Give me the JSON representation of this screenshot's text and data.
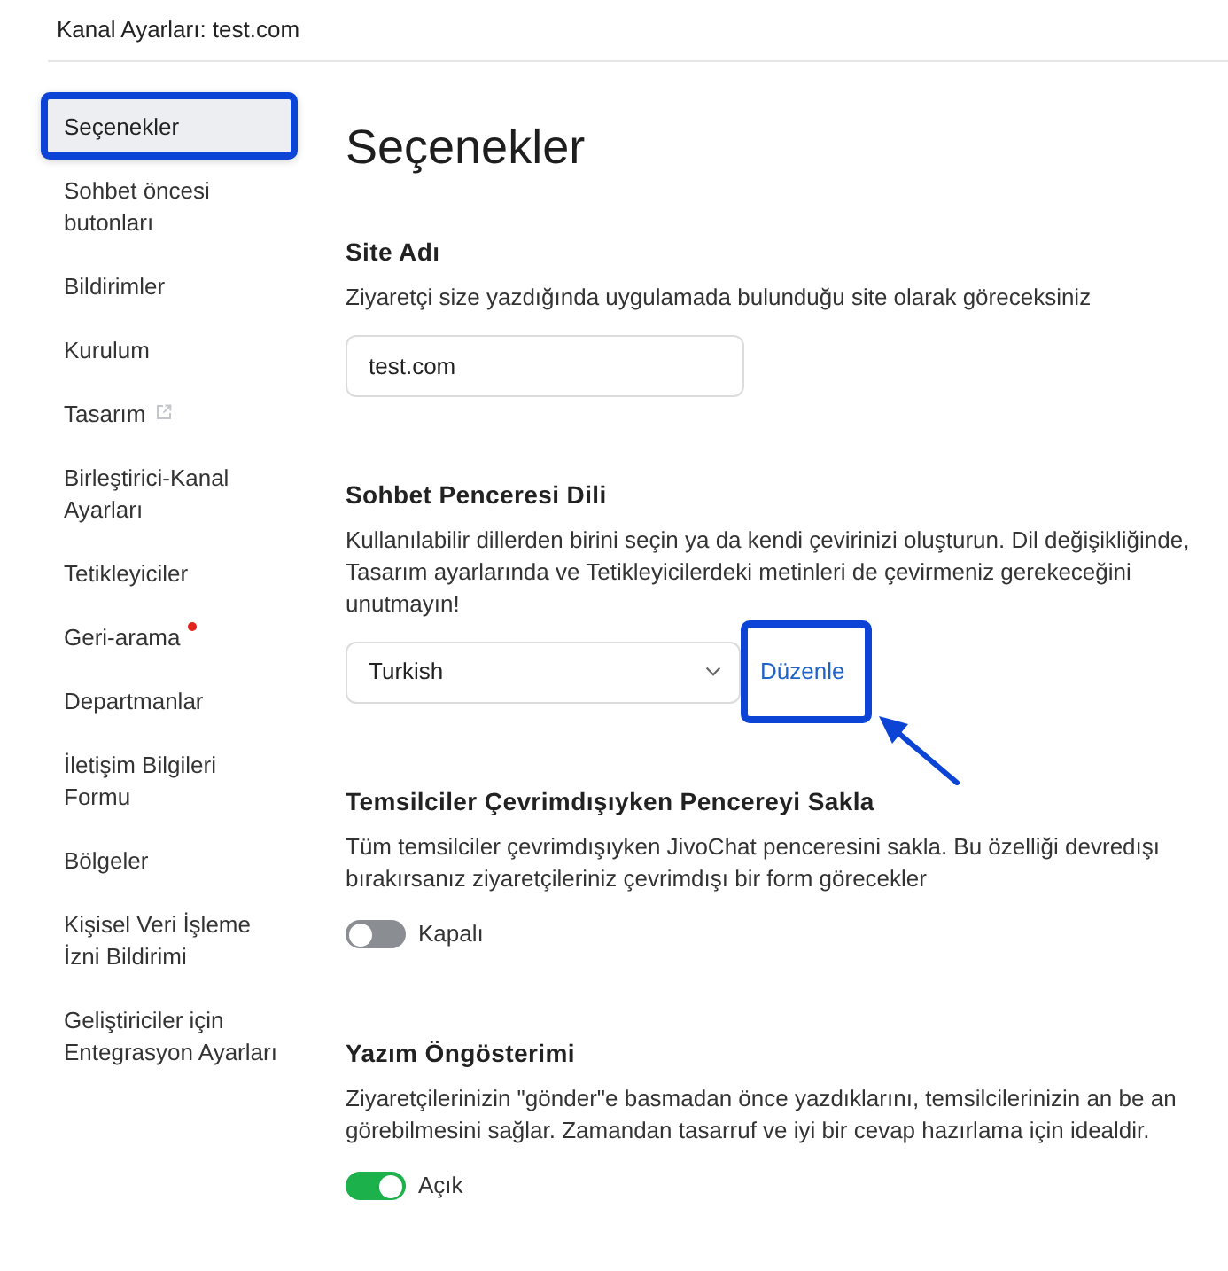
{
  "header": {
    "title": "Kanal Ayarları: test.com"
  },
  "sidebar": {
    "items": [
      {
        "label": "Seçenekler",
        "kind": "plain",
        "selected": true,
        "highlighted": true
      },
      {
        "label": "Sohbet öncesi butonları",
        "kind": "plain",
        "selected": false,
        "highlighted": false
      },
      {
        "label": "Bildirimler",
        "kind": "plain",
        "selected": false,
        "highlighted": false
      },
      {
        "label": "Kurulum",
        "kind": "plain",
        "selected": false,
        "highlighted": false
      },
      {
        "label": "Tasarım",
        "kind": "external",
        "selected": false,
        "highlighted": false
      },
      {
        "label": "Birleştirici-Kanal Ayarları",
        "kind": "plain",
        "selected": false,
        "highlighted": false
      },
      {
        "label": "Tetikleyiciler",
        "kind": "plain",
        "selected": false,
        "highlighted": false
      },
      {
        "label": "Geri-arama",
        "kind": "notification",
        "selected": false,
        "highlighted": false
      },
      {
        "label": "Departmanlar",
        "kind": "plain",
        "selected": false,
        "highlighted": false
      },
      {
        "label": "İletişim Bilgileri Formu",
        "kind": "plain",
        "selected": false,
        "highlighted": false
      },
      {
        "label": "Bölgeler",
        "kind": "plain",
        "selected": false,
        "highlighted": false
      },
      {
        "label": "Kişisel Veri İşleme İzni Bildirimi",
        "kind": "plain",
        "selected": false,
        "highlighted": false
      },
      {
        "label": "Geliştiriciler için Entegrasyon Ayarları",
        "kind": "plain",
        "selected": false,
        "highlighted": false
      }
    ]
  },
  "main": {
    "heading": "Seçenekler",
    "sections": [
      {
        "kind": "text_field",
        "title": "Site Adı",
        "description": "Ziyaretçi size yazdığında uygulamada bulunduğu site olarak göreceksiniz",
        "value": "test.com"
      },
      {
        "kind": "select",
        "title": "Sohbet Penceresi Dili",
        "description": "Kullanılabilir dillerden birini seçin ya da kendi çevirinizi oluşturun. Dil değişikliğinde, Tasarım ayarlarında ve Tetikleyicilerdeki metinleri de çevirmeniz gerekeceğini unutmayın!",
        "value": "Turkish",
        "link": {
          "label": "Düzenle",
          "highlighted": true,
          "callout_arrow": true
        }
      },
      {
        "kind": "toggle",
        "title": "Temsilciler Çevrimdışıyken Pencereyi Sakla",
        "description": "Tüm temsilciler çevrimdışıyken JivoChat penceresini sakla. Bu özelliği devredışı bırakırsanız ziyaretçileriniz çevrimdışı bir form görecekler",
        "on": false,
        "state_label": "Kapalı"
      },
      {
        "kind": "toggle",
        "title": "Yazım Öngösterimi",
        "description": "Ziyaretçilerinizin \"gönder\"e basmadan önce yazdıklarını, temsilcilerinizin an be an görebilmesini sağlar. Zamandan tasarruf ve iyi bir cevap hazırlama için idealdir.",
        "on": true,
        "state_label": "Açık"
      }
    ]
  }
}
